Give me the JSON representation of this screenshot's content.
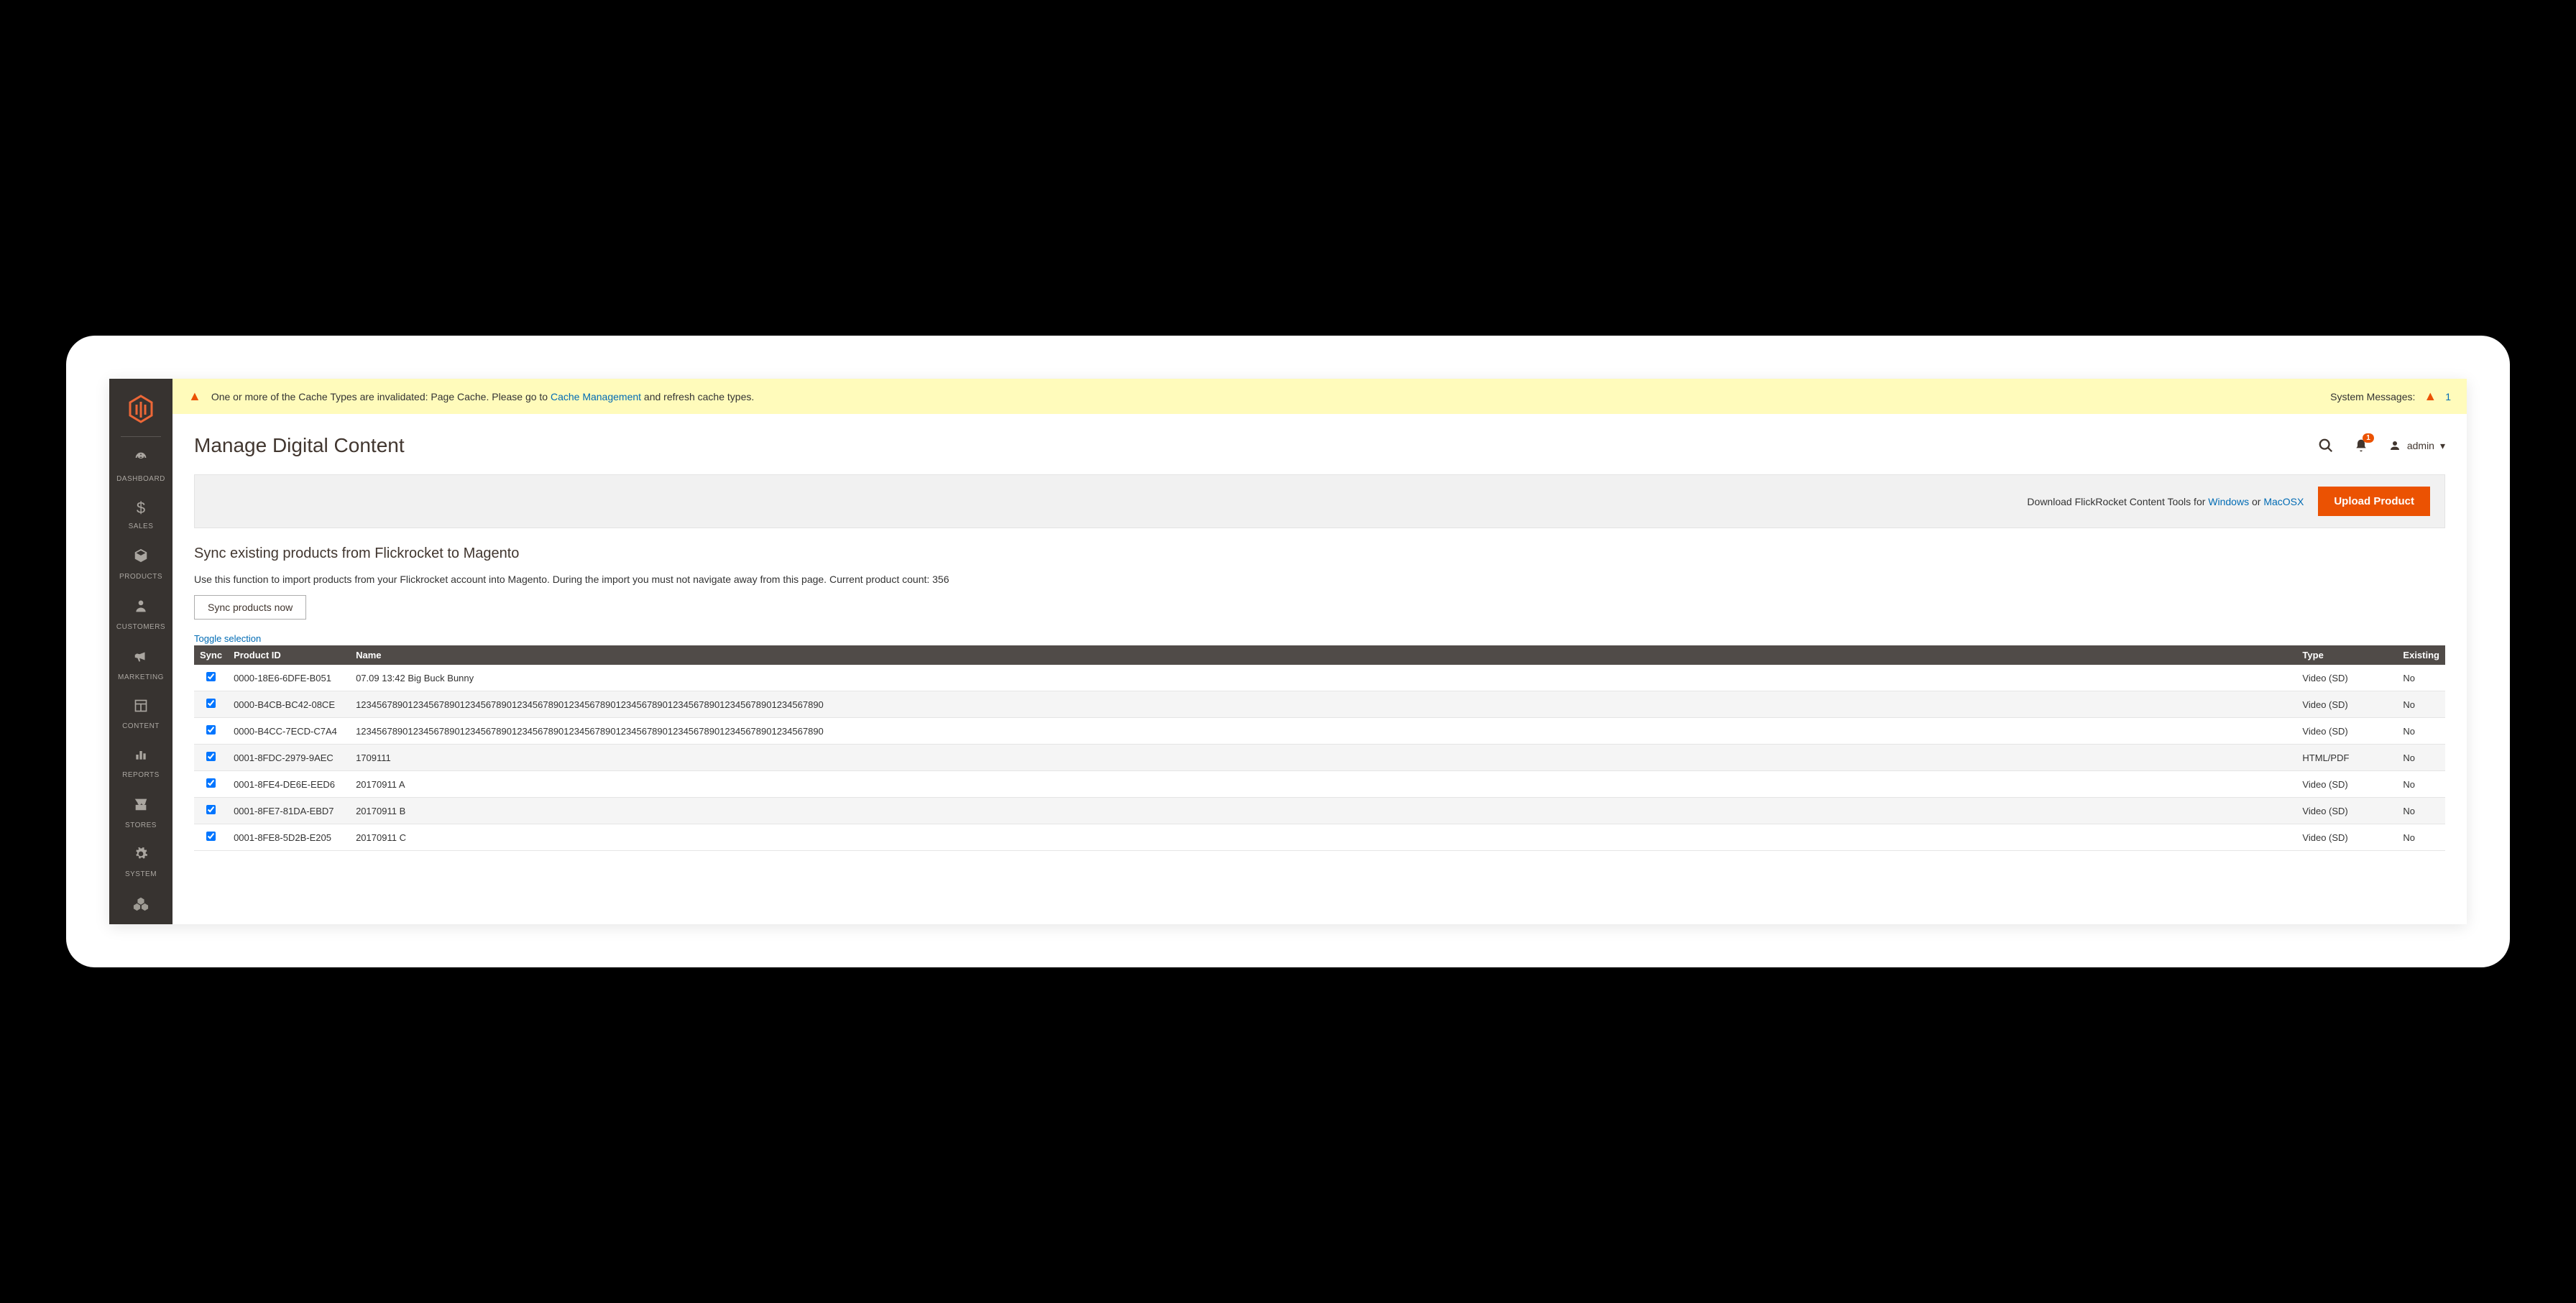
{
  "sys_msg": {
    "text_before": "One or more of the Cache Types are invalidated: Page Cache. Please go to ",
    "link": "Cache Management",
    "text_after": " and refresh cache types.",
    "label": "System Messages:",
    "count": "1"
  },
  "sidebar": {
    "items": [
      {
        "label": "DASHBOARD"
      },
      {
        "label": "SALES"
      },
      {
        "label": "PRODUCTS"
      },
      {
        "label": "CUSTOMERS"
      },
      {
        "label": "MARKETING"
      },
      {
        "label": "CONTENT"
      },
      {
        "label": "REPORTS"
      },
      {
        "label": "STORES"
      },
      {
        "label": "SYSTEM"
      }
    ]
  },
  "page_title": "Manage Digital Content",
  "admin_user": "admin",
  "notif_count": "1",
  "action_bar": {
    "download_prefix": "Download FlickRocket Content Tools for ",
    "win": "Windows",
    "or": " or ",
    "mac": "MacOSX",
    "upload_btn": "Upload Product"
  },
  "sync": {
    "heading": "Sync existing products from Flickrocket to Magento",
    "desc": "Use this function to import products from your Flickrocket account into Magento. During the import you must not navigate away from this page. Current product count: 356",
    "btn": "Sync products now",
    "toggle": "Toggle selection"
  },
  "table": {
    "headers": {
      "sync": "Sync",
      "pid": "Product ID",
      "name": "Name",
      "type": "Type",
      "existing": "Existing"
    },
    "rows": [
      {
        "pid": "0000-18E6-6DFE-B051",
        "name": "07.09 13:42 Big Buck Bunny",
        "type": "Video (SD)",
        "existing": "No"
      },
      {
        "pid": "0000-B4CB-BC42-08CE",
        "name": "123456789012345678901234567890123456789012345678901234567890123456789012345678901234567890",
        "type": "Video (SD)",
        "existing": "No"
      },
      {
        "pid": "0000-B4CC-7ECD-C7A4",
        "name": "123456789012345678901234567890123456789012345678901234567890123456789012345678901234567890",
        "type": "Video (SD)",
        "existing": "No"
      },
      {
        "pid": "0001-8FDC-2979-9AEC",
        "name": "1709111",
        "type": "HTML/PDF",
        "existing": "No"
      },
      {
        "pid": "0001-8FE4-DE6E-EED6",
        "name": "20170911 A",
        "type": "Video (SD)",
        "existing": "No"
      },
      {
        "pid": "0001-8FE7-81DA-EBD7",
        "name": "20170911 B",
        "type": "Video (SD)",
        "existing": "No"
      },
      {
        "pid": "0001-8FE8-5D2B-E205",
        "name": "20170911 C",
        "type": "Video (SD)",
        "existing": "No"
      }
    ]
  }
}
